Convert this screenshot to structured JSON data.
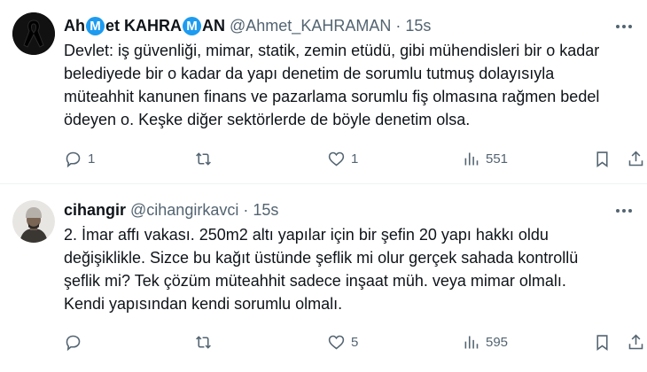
{
  "tweets": [
    {
      "name_parts": [
        "Ah",
        "M",
        "et KAHRA",
        "M",
        "AN"
      ],
      "handle": "@Ahmet_KAHRAMAN",
      "dot": "·",
      "time": "15s",
      "text_lines": [
        "Devlet: iş güvenliği, mimar, statik, zemin etüdü, gibi mühendisleri bir o kadar",
        "belediyede bir o kadar da yapı denetim de sorumlu tutmuş dolayısıyla",
        "müteahhit kanunen finans ve pazarlama sorumlu fiş olmasına rağmen bedel",
        "ödeyen o. Keşke diğer sektörlerde de böyle denetim olsa."
      ],
      "replies": "1",
      "retweets": "",
      "likes": "1",
      "views": "551"
    },
    {
      "name": "cihangir",
      "handle": "@cihangirkavci",
      "dot": "·",
      "time": "15s",
      "text_lines": [
        "2. İmar affı vakası. 250m2 altı yapılar için bir şefin 20 yapı hakkı oldu",
        "değişiklikle. Sizce bu kağıt üstünde şeflik mi olur gerçek sahada kontrollü",
        "şeflik mi? Tek çözüm müteahhit sadece inşaat müh. veya mimar olmalı.",
        "Kendi yapısından kendi sorumlu olmalı."
      ],
      "replies": "",
      "retweets": "",
      "likes": "5",
      "views": "595"
    }
  ],
  "icons": {
    "more": "more-horizontal-icon",
    "reply": "reply-icon",
    "retweet": "retweet-icon",
    "like": "heart-icon",
    "views": "views-icon",
    "bookmark": "bookmark-icon",
    "share": "share-icon"
  },
  "colors": {
    "text": "#0f1419",
    "secondary": "#536471",
    "verified_badge": "#1d9bf0",
    "divider": "#eff3f4"
  }
}
